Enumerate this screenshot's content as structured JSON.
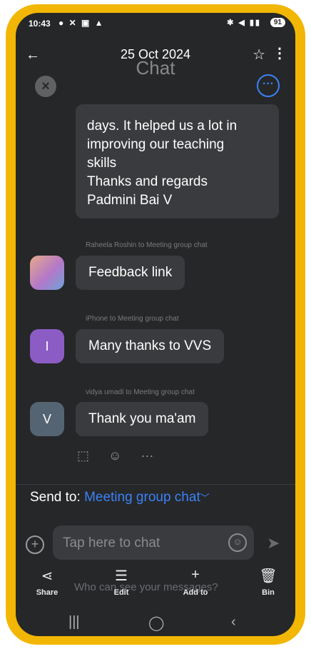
{
  "status_bar": {
    "time": "10:43",
    "battery": "91"
  },
  "header": {
    "date": "25 Oct 2024",
    "title": "Chat"
  },
  "messages": {
    "continued": {
      "lines": [
        "days. It helped us a lot in",
        "improving our teaching",
        "skills",
        "Thanks and regards",
        "Padmini Bai V"
      ]
    },
    "items": [
      {
        "meta": "Raheela Roshin to Meeting group chat",
        "avatar": "",
        "text": "Feedback link"
      },
      {
        "meta": "iPhone to Meeting group chat",
        "avatar": "I",
        "text": "Many thanks to VVS"
      },
      {
        "meta": "vidya umadi to Meeting group chat",
        "avatar": "V",
        "text": "Thank you ma'am"
      }
    ]
  },
  "reactions": {
    "more": "···"
  },
  "send_to": {
    "label": "Send to:",
    "target": "Meeting group chat"
  },
  "composer": {
    "placeholder": "Tap here to chat"
  },
  "privacy_note": "Who can see your messages?",
  "actions": [
    {
      "label": "Share",
      "icon": "share-icon"
    },
    {
      "label": "Edit",
      "icon": "edit-icon"
    },
    {
      "label": "Add to",
      "icon": "add-icon"
    },
    {
      "label": "Bin",
      "icon": "bin-icon"
    }
  ],
  "colors": {
    "frame": "#f2b705",
    "background": "#262729",
    "bubble": "#3a3b3e",
    "accent": "#3b82f6"
  }
}
